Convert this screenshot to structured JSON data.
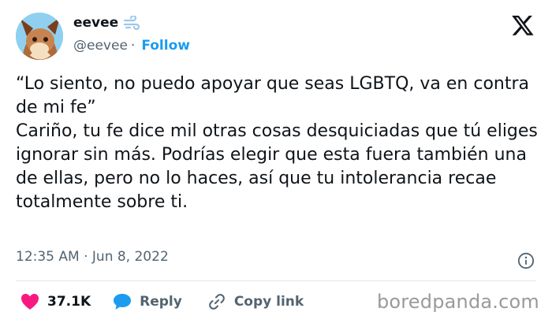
{
  "author": {
    "name": "eevee",
    "handle": "@eevee",
    "follow_label": "Follow",
    "separator": "·"
  },
  "tweet": {
    "text": "“Lo siento, no puedo apoyar que seas LGBTQ, va en contra de mi fe”\nCariño, tu fe dice mil otras cosas desquiciadas que tú eliges ignorar sin más. Podrías elegir que esta fuera también una de ellas, pero no lo haces, así que tu intolerancia recae totalmente sobre ti."
  },
  "meta": {
    "timestamp": "12:35 AM · Jun 8, 2022"
  },
  "actions": {
    "likes": "37.1K",
    "reply_label": "Reply",
    "copy_link_label": "Copy link"
  },
  "watermark": "boredpanda.com",
  "colors": {
    "accent": "#1d9bf0",
    "like": "#f91880",
    "muted": "#536471"
  },
  "icons": [
    "x-logo-icon",
    "info-icon",
    "heart-icon",
    "reply-bubble-icon",
    "link-icon",
    "wind-emoji-icon"
  ]
}
